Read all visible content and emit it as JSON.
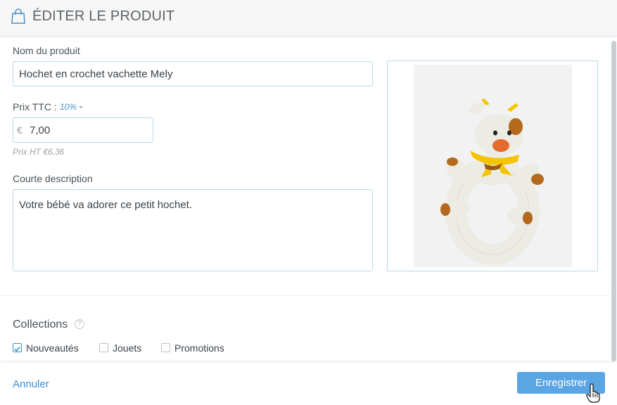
{
  "header": {
    "title": "ÉDITER LE PRODUIT",
    "icon": "shopping-bag-icon"
  },
  "form": {
    "name_label": "Nom du produit",
    "name_value": "Hochet en crochet vachette Mely",
    "price_label": "Prix TTC :",
    "vat_rate": "10%",
    "currency_symbol": "€",
    "price_value": "7,00",
    "price_ht": "Prix HT €6,36",
    "desc_label": "Courte description",
    "desc_value": "Votre bébé va adorer ce petit hochet."
  },
  "collections": {
    "title": "Collections",
    "help": "?",
    "items": [
      {
        "label": "Nouveautés",
        "checked": true
      },
      {
        "label": "Jouets",
        "checked": false
      },
      {
        "label": "Promotions",
        "checked": false
      }
    ]
  },
  "footer": {
    "cancel_label": "Annuler",
    "save_label": "Enregistrer"
  },
  "colors": {
    "accent": "#3a8fd0",
    "button": "#5aa5e4",
    "input_border": "#b8dbe8"
  }
}
